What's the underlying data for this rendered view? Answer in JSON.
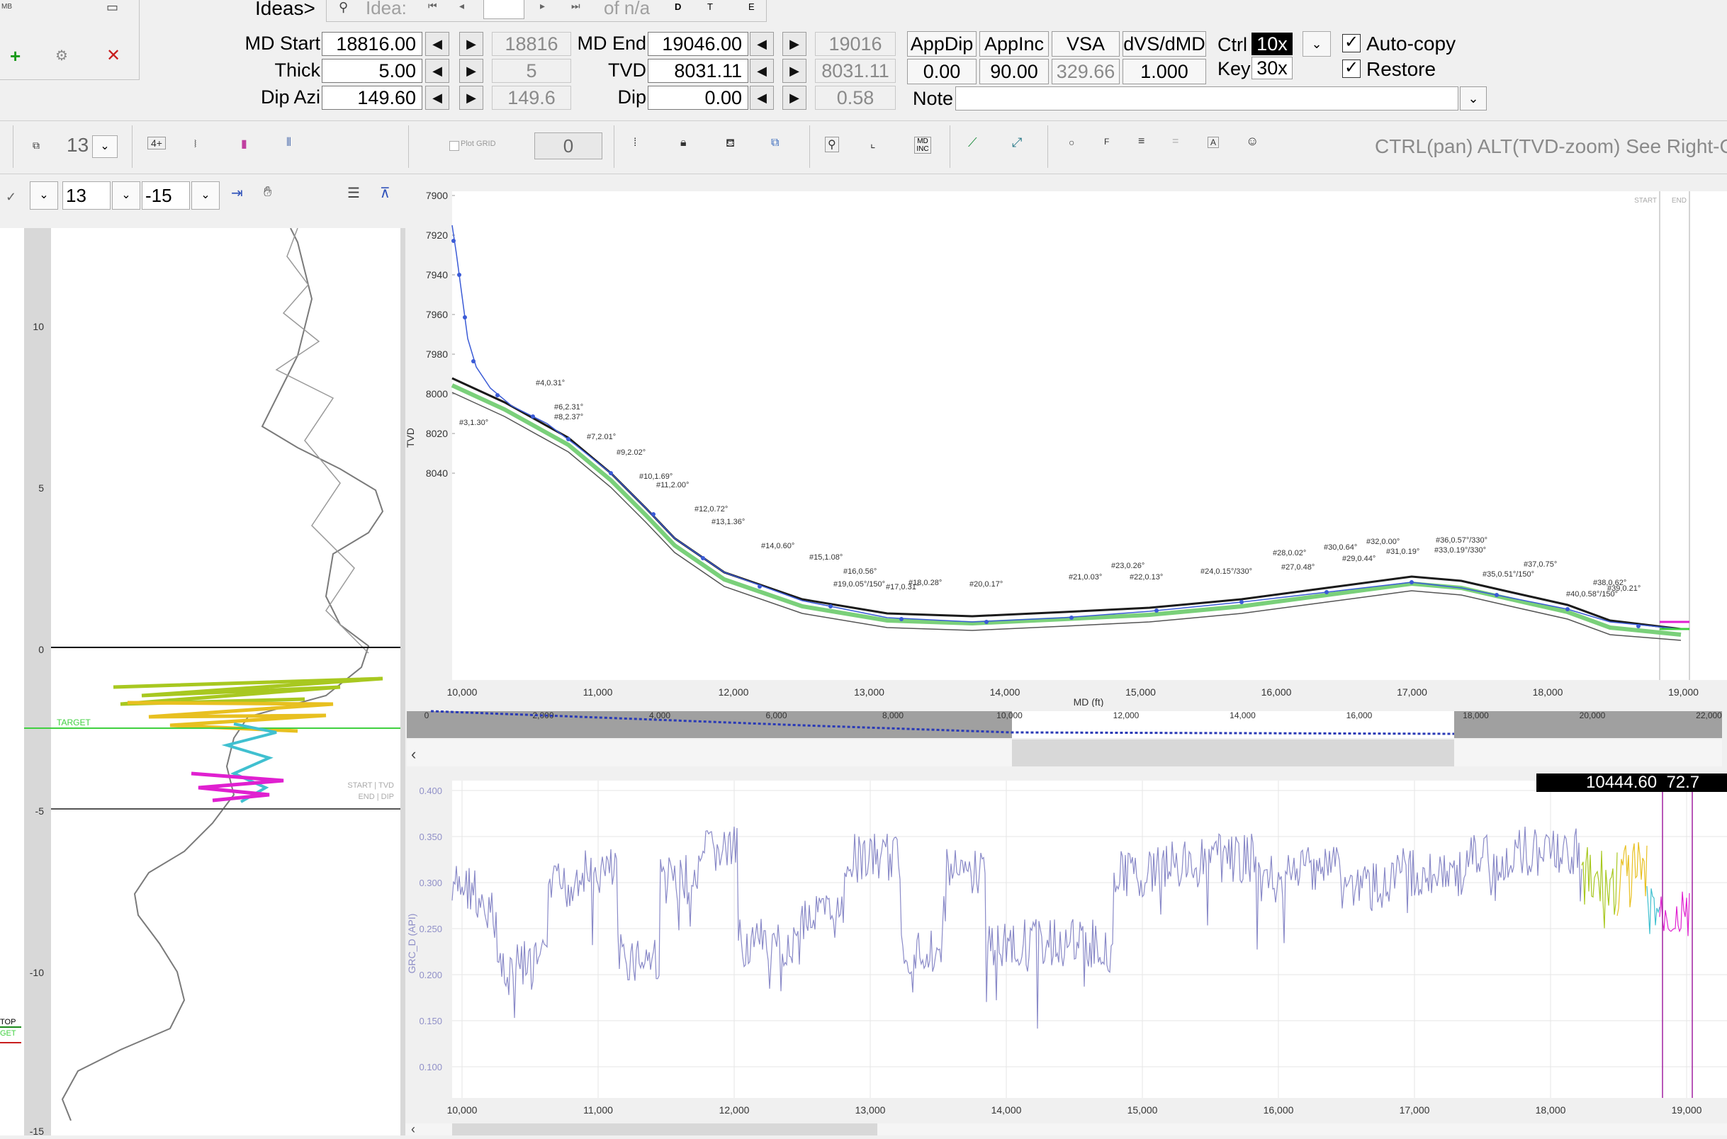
{
  "ideas_bar": {
    "label": "Ideas>",
    "idea_placeholder": "Idea:",
    "of_label": "of n/a",
    "buttons": [
      "D",
      "T",
      "E"
    ]
  },
  "sidebar_top": {
    "mb_label": "MB"
  },
  "params": {
    "md_start": {
      "label": "MD Start",
      "value": "18816.00",
      "ref": "18816"
    },
    "thick": {
      "label": "Thick",
      "value": "5.00",
      "ref": "5"
    },
    "dip_azi": {
      "label": "Dip Azi",
      "value": "149.60",
      "ref": "149.6"
    },
    "md_end": {
      "label": "MD End",
      "value": "19046.00",
      "ref": "19016"
    },
    "tvd": {
      "label": "TVD",
      "value": "8031.11",
      "ref": "8031.11"
    },
    "dip": {
      "label": "Dip",
      "value": "0.00",
      "ref": "0.58"
    }
  },
  "app_table": {
    "headers": [
      "AppDip",
      "AppInc",
      "VSA",
      "dVS/dMD"
    ],
    "values": [
      "0.00",
      "90.00",
      "329.66",
      "1.000"
    ]
  },
  "ctrl_key": {
    "ctrl_label": "Ctrl",
    "ctrl_value": "10x",
    "key_label": "Key",
    "key_value": "30x"
  },
  "options": {
    "auto_copy": "Auto-copy",
    "restore": "Restore"
  },
  "note": {
    "label": "Note",
    "value": ""
  },
  "toolbar": {
    "count_value": "13",
    "plot_grid_label": "Plot GRID",
    "grid_value": "0",
    "md_inc_label": "MD INC",
    "hint": "CTRL(pan) ALT(TVD-zoom) See Right-Clic"
  },
  "left_controls": {
    "value_a": "13",
    "value_b": "-15"
  },
  "left_track": {
    "y_ticks": [
      "10",
      "5",
      "0",
      "-5",
      "-10",
      "-15"
    ],
    "labels": {
      "target": "TARGET",
      "start_tvd": "START | TVD",
      "end_dip": "END | DIP",
      "top": "TOP",
      "get": "GET"
    }
  },
  "tvd_plot": {
    "ylabel": "TVD",
    "xlabel": "MD (ft)",
    "y_ticks": [
      "7900",
      "7920",
      "7940",
      "7960",
      "7980",
      "8000",
      "8020",
      "8040"
    ],
    "x_ticks": [
      "10,000",
      "11,000",
      "12,000",
      "13,000",
      "14,000",
      "15,000",
      "16,000",
      "17,000",
      "18,000",
      "19,000"
    ],
    "corner_labels": [
      "START",
      "END"
    ],
    "segments": [
      "#3,1.30°",
      "#4,0.31°",
      "#6,2.31°",
      "#8,2.37°",
      "#7,2.01°",
      "#9,2.02°",
      "#10,1.69°",
      "#11,2.00°",
      "#12,0.72°",
      "#13,1.36°",
      "#14,0.60°",
      "#15,1.08°",
      "#16,0.56°",
      "#19,0.05°/150°",
      "#17,0.31°",
      "#18,0.28°",
      "#20,0.17°",
      "#21,0.03°",
      "#23,0.26°",
      "#22,0.13°",
      "#24,0.15°/330°",
      "#27,0.48°",
      "#28,0.02°",
      "#30,0.64°",
      "#29,0.44°",
      "#32,0.00°",
      "#31,0.19°",
      "#36,0.57°/330°",
      "#33,0.19°/330°",
      "#35,0.51°/150°",
      "#37,0.75°",
      "#38,0.62°",
      "#40,0.58°/150°",
      "#39,0.21°"
    ]
  },
  "overview": {
    "ticks": [
      "0",
      "2,000",
      "4,000",
      "6,000",
      "8,000",
      "10,000",
      "12,000",
      "14,000",
      "16,000",
      "18,000",
      "20,000",
      "22,000"
    ]
  },
  "gr_plot": {
    "ylabel": "GRC_D (API)",
    "y_ticks": [
      "0.400",
      "0.350",
      "0.300",
      "0.250",
      "0.200",
      "0.150",
      "0.100"
    ],
    "x_ticks": [
      "10,000",
      "11,000",
      "12,000",
      "13,000",
      "14,000",
      "15,000",
      "16,000",
      "17,000",
      "18,000",
      "19,000"
    ],
    "readout": "10444.60  72.7"
  },
  "colors": {
    "trajectory": "#3b5bd6",
    "gr_curve": "#8a8ac8",
    "lime": "#a8c820",
    "yellow": "#e8c020",
    "cyan": "#40c0d0",
    "magenta": "#e020d0",
    "target_green": "#40d040"
  }
}
